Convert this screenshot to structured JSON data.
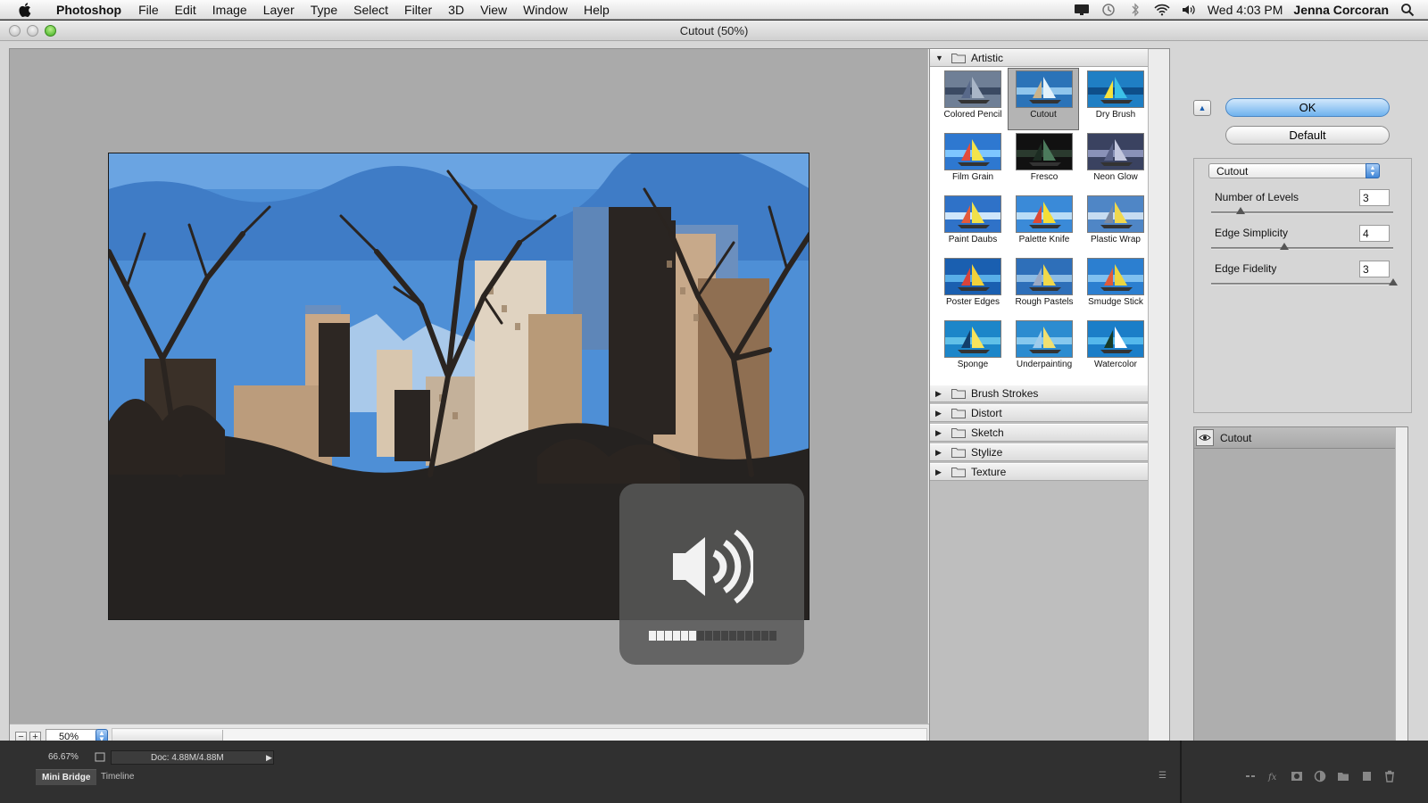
{
  "menubar": {
    "app_name": "Photoshop",
    "items": [
      "File",
      "Edit",
      "Image",
      "Layer",
      "Type",
      "Select",
      "Filter",
      "3D",
      "View",
      "Window",
      "Help"
    ],
    "clock": "Wed 4:03 PM",
    "user": "Jenna Corcoran",
    "status_icons": [
      "display-icon",
      "time-machine-icon",
      "bluetooth-icon",
      "wifi-icon",
      "volume-icon",
      "spotlight-search-icon"
    ]
  },
  "window": {
    "title": "Cutout (50%)"
  },
  "preview": {
    "zoom": "50%",
    "zoom_out_icon": "−",
    "zoom_in_icon": "+"
  },
  "volume_hud": {
    "icon": "speaker-icon",
    "level_segments_on": 6,
    "total_segments": 16
  },
  "gallery": {
    "categories": [
      {
        "label": "Artistic",
        "expanded": true
      },
      {
        "label": "Brush Strokes",
        "expanded": false
      },
      {
        "label": "Distort",
        "expanded": false
      },
      {
        "label": "Sketch",
        "expanded": false
      },
      {
        "label": "Stylize",
        "expanded": false
      },
      {
        "label": "Texture",
        "expanded": false
      }
    ],
    "artistic_filters": [
      {
        "label": "Colored Pencil"
      },
      {
        "label": "Cutout",
        "selected": true
      },
      {
        "label": "Dry Brush"
      },
      {
        "label": "Film Grain"
      },
      {
        "label": "Fresco"
      },
      {
        "label": "Neon Glow"
      },
      {
        "label": "Paint Daubs"
      },
      {
        "label": "Palette Knife"
      },
      {
        "label": "Plastic Wrap"
      },
      {
        "label": "Poster Edges"
      },
      {
        "label": "Rough Pastels"
      },
      {
        "label": "Smudge Stick"
      },
      {
        "label": "Sponge"
      },
      {
        "label": "Underpainting"
      },
      {
        "label": "Watercolor"
      }
    ]
  },
  "settings": {
    "ok_label": "OK",
    "default_label": "Default",
    "filter_select": "Cutout",
    "params": [
      {
        "label": "Number of Levels",
        "value": "3",
        "slider_fraction": 0.16
      },
      {
        "label": "Edge Simplicity",
        "value": "4",
        "slider_fraction": 0.4
      },
      {
        "label": "Edge Fidelity",
        "value": "3",
        "slider_fraction": 1.0
      }
    ],
    "effect_layer": "Cutout"
  },
  "statusbar": {
    "zoom_percent": "66.67%",
    "doc_size": "Doc: 4.88M/4.88M",
    "tabs": [
      "Mini Bridge",
      "Timeline"
    ]
  },
  "colors": {
    "ok_button": "#7fbaf0",
    "accent": "#3f86d7"
  }
}
